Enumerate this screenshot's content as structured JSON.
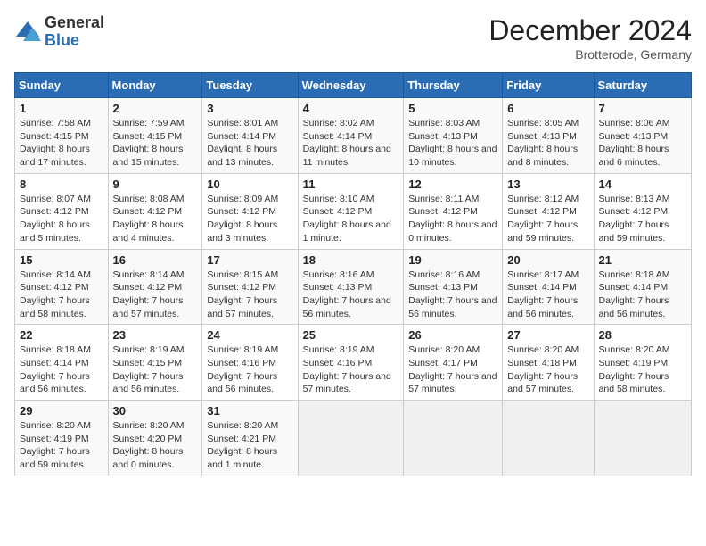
{
  "header": {
    "logo_general": "General",
    "logo_blue": "Blue",
    "month_title": "December 2024",
    "location": "Brotterode, Germany"
  },
  "days_of_week": [
    "Sunday",
    "Monday",
    "Tuesday",
    "Wednesday",
    "Thursday",
    "Friday",
    "Saturday"
  ],
  "weeks": [
    [
      {
        "day": "1",
        "info": "Sunrise: 7:58 AM\nSunset: 4:15 PM\nDaylight: 8 hours and 17 minutes."
      },
      {
        "day": "2",
        "info": "Sunrise: 7:59 AM\nSunset: 4:15 PM\nDaylight: 8 hours and 15 minutes."
      },
      {
        "day": "3",
        "info": "Sunrise: 8:01 AM\nSunset: 4:14 PM\nDaylight: 8 hours and 13 minutes."
      },
      {
        "day": "4",
        "info": "Sunrise: 8:02 AM\nSunset: 4:14 PM\nDaylight: 8 hours and 11 minutes."
      },
      {
        "day": "5",
        "info": "Sunrise: 8:03 AM\nSunset: 4:13 PM\nDaylight: 8 hours and 10 minutes."
      },
      {
        "day": "6",
        "info": "Sunrise: 8:05 AM\nSunset: 4:13 PM\nDaylight: 8 hours and 8 minutes."
      },
      {
        "day": "7",
        "info": "Sunrise: 8:06 AM\nSunset: 4:13 PM\nDaylight: 8 hours and 6 minutes."
      }
    ],
    [
      {
        "day": "8",
        "info": "Sunrise: 8:07 AM\nSunset: 4:12 PM\nDaylight: 8 hours and 5 minutes."
      },
      {
        "day": "9",
        "info": "Sunrise: 8:08 AM\nSunset: 4:12 PM\nDaylight: 8 hours and 4 minutes."
      },
      {
        "day": "10",
        "info": "Sunrise: 8:09 AM\nSunset: 4:12 PM\nDaylight: 8 hours and 3 minutes."
      },
      {
        "day": "11",
        "info": "Sunrise: 8:10 AM\nSunset: 4:12 PM\nDaylight: 8 hours and 1 minute."
      },
      {
        "day": "12",
        "info": "Sunrise: 8:11 AM\nSunset: 4:12 PM\nDaylight: 8 hours and 0 minutes."
      },
      {
        "day": "13",
        "info": "Sunrise: 8:12 AM\nSunset: 4:12 PM\nDaylight: 7 hours and 59 minutes."
      },
      {
        "day": "14",
        "info": "Sunrise: 8:13 AM\nSunset: 4:12 PM\nDaylight: 7 hours and 59 minutes."
      }
    ],
    [
      {
        "day": "15",
        "info": "Sunrise: 8:14 AM\nSunset: 4:12 PM\nDaylight: 7 hours and 58 minutes."
      },
      {
        "day": "16",
        "info": "Sunrise: 8:14 AM\nSunset: 4:12 PM\nDaylight: 7 hours and 57 minutes."
      },
      {
        "day": "17",
        "info": "Sunrise: 8:15 AM\nSunset: 4:12 PM\nDaylight: 7 hours and 57 minutes."
      },
      {
        "day": "18",
        "info": "Sunrise: 8:16 AM\nSunset: 4:13 PM\nDaylight: 7 hours and 56 minutes."
      },
      {
        "day": "19",
        "info": "Sunrise: 8:16 AM\nSunset: 4:13 PM\nDaylight: 7 hours and 56 minutes."
      },
      {
        "day": "20",
        "info": "Sunrise: 8:17 AM\nSunset: 4:14 PM\nDaylight: 7 hours and 56 minutes."
      },
      {
        "day": "21",
        "info": "Sunrise: 8:18 AM\nSunset: 4:14 PM\nDaylight: 7 hours and 56 minutes."
      }
    ],
    [
      {
        "day": "22",
        "info": "Sunrise: 8:18 AM\nSunset: 4:14 PM\nDaylight: 7 hours and 56 minutes."
      },
      {
        "day": "23",
        "info": "Sunrise: 8:19 AM\nSunset: 4:15 PM\nDaylight: 7 hours and 56 minutes."
      },
      {
        "day": "24",
        "info": "Sunrise: 8:19 AM\nSunset: 4:16 PM\nDaylight: 7 hours and 56 minutes."
      },
      {
        "day": "25",
        "info": "Sunrise: 8:19 AM\nSunset: 4:16 PM\nDaylight: 7 hours and 57 minutes."
      },
      {
        "day": "26",
        "info": "Sunrise: 8:20 AM\nSunset: 4:17 PM\nDaylight: 7 hours and 57 minutes."
      },
      {
        "day": "27",
        "info": "Sunrise: 8:20 AM\nSunset: 4:18 PM\nDaylight: 7 hours and 57 minutes."
      },
      {
        "day": "28",
        "info": "Sunrise: 8:20 AM\nSunset: 4:19 PM\nDaylight: 7 hours and 58 minutes."
      }
    ],
    [
      {
        "day": "29",
        "info": "Sunrise: 8:20 AM\nSunset: 4:19 PM\nDaylight: 7 hours and 59 minutes."
      },
      {
        "day": "30",
        "info": "Sunrise: 8:20 AM\nSunset: 4:20 PM\nDaylight: 8 hours and 0 minutes."
      },
      {
        "day": "31",
        "info": "Sunrise: 8:20 AM\nSunset: 4:21 PM\nDaylight: 8 hours and 1 minute."
      },
      null,
      null,
      null,
      null
    ]
  ]
}
